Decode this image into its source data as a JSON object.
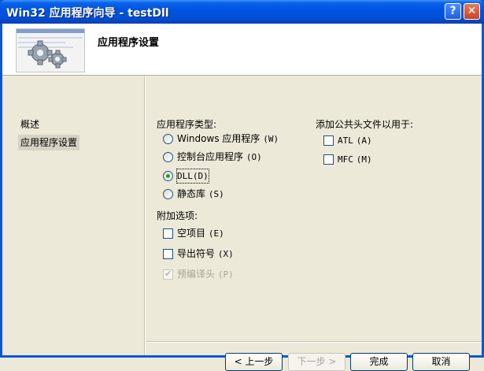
{
  "window": {
    "title": "Win32 应用程序向导 - testDll",
    "help_label": "?",
    "close_label": "✕"
  },
  "header": {
    "title": "应用程序设置",
    "image_icon": "gears-icon"
  },
  "nav": {
    "items": [
      {
        "label": "概述",
        "active": false
      },
      {
        "label": "应用程序设置",
        "active": true
      }
    ]
  },
  "app_type": {
    "label": "应用程序类型:",
    "options": [
      {
        "text": "Windows 应用程序",
        "key": "(W)",
        "checked": false
      },
      {
        "text": "控制台应用程序",
        "key": "(O)",
        "checked": false
      },
      {
        "text": "DLL",
        "key": "(D)",
        "checked": true
      },
      {
        "text": "静态库",
        "key": "(S)",
        "checked": false
      }
    ]
  },
  "extra_options": {
    "label": "附加选项:",
    "options": [
      {
        "text": "空项目",
        "key": "(E)",
        "checked": false,
        "enabled": true
      },
      {
        "text": "导出符号",
        "key": "(X)",
        "checked": false,
        "enabled": true
      },
      {
        "text": "预编译头",
        "key": "(P)",
        "checked": true,
        "enabled": false
      }
    ]
  },
  "common_headers": {
    "label": "添加公共头文件以用于:",
    "options": [
      {
        "text": "ATL",
        "key": "(A)",
        "checked": false
      },
      {
        "text": "MFC",
        "key": "(M)",
        "checked": false
      }
    ]
  },
  "buttons": {
    "prev": "< 上一步",
    "next": "下一步 >",
    "finish": "完成",
    "cancel": "取消"
  }
}
